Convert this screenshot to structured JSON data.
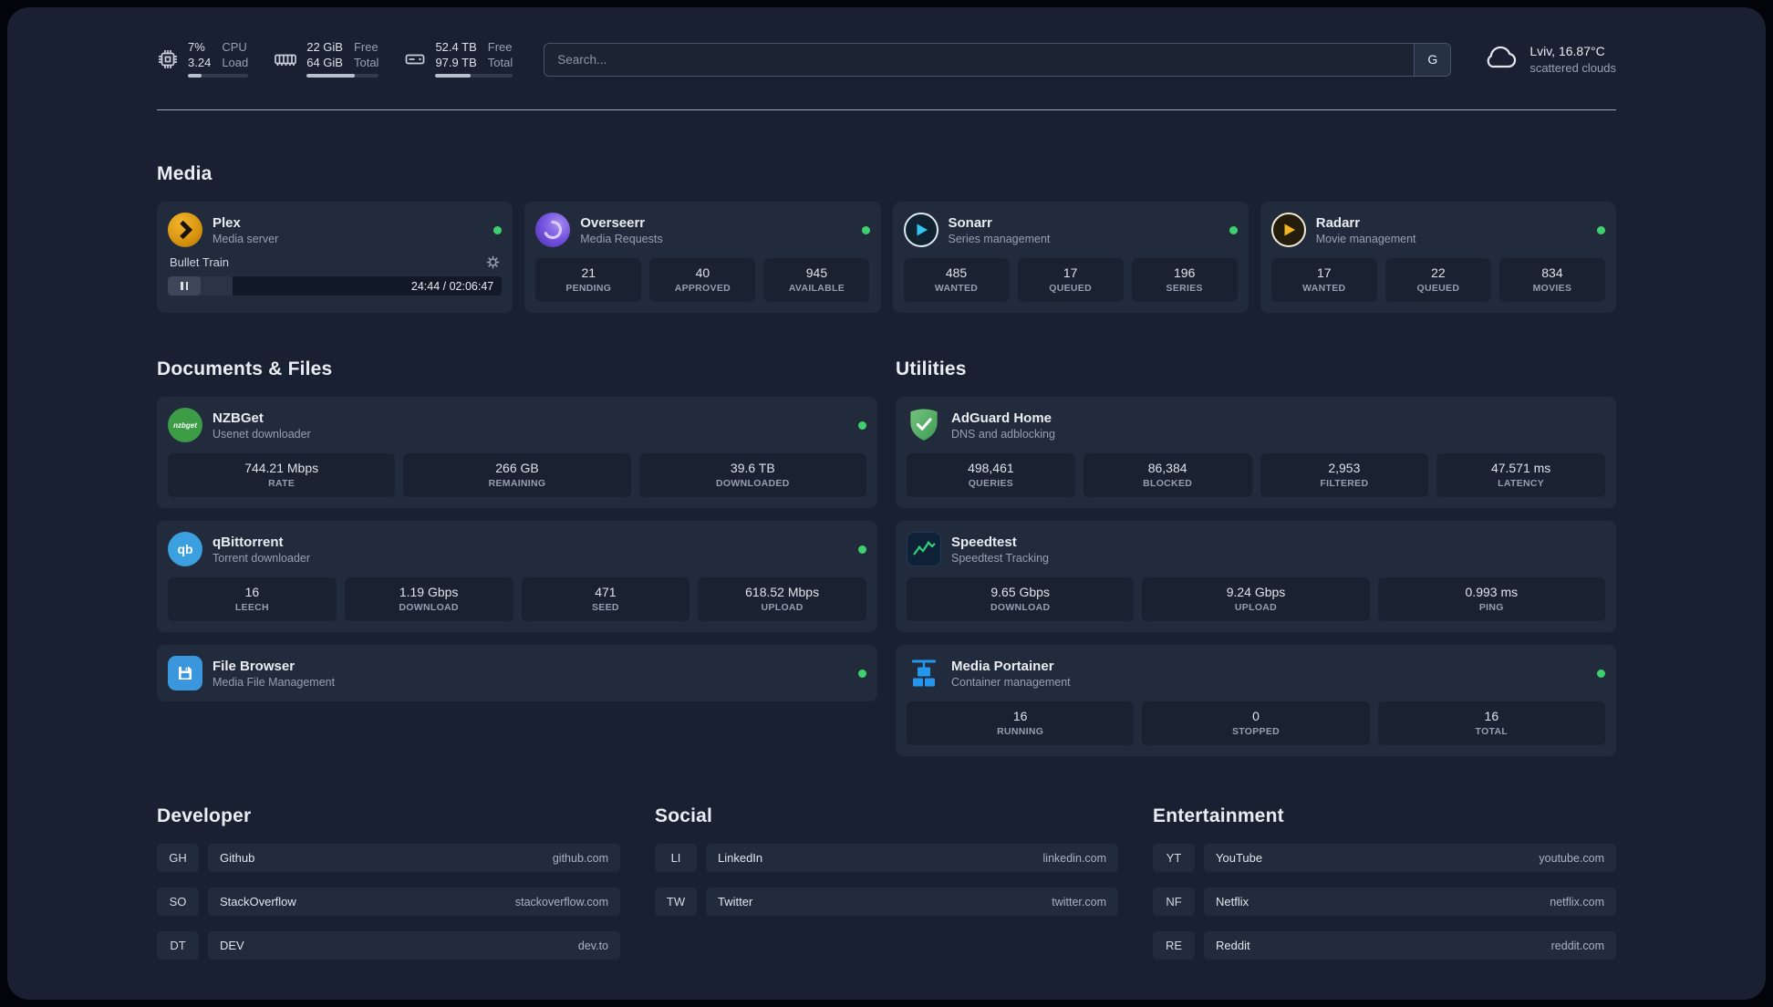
{
  "colors": {
    "status_online": "#3ecf6e",
    "accent_plex": "#e5a00d",
    "accent_overseerr": "#6741d9",
    "accent_sonarr": "#35c5f4",
    "accent_radarr": "#f3b61f",
    "accent_nzbget": "#3d9c46",
    "accent_qbittorrent": "#3b9fe0",
    "accent_filebrowser": "#3b97dd",
    "accent_adguard": "#5fb370",
    "accent_speedtest_line": "#2fd17c",
    "accent_portainer": "#2496ed"
  },
  "topbar": {
    "cpu": {
      "value1": "7%",
      "label1": "CPU",
      "value2": "3.24",
      "label2": "Load",
      "progress_pct": "22%"
    },
    "memory": {
      "value1": "22 GiB",
      "label1": "Free",
      "value2": "64 GiB",
      "label2": "Total",
      "progress_pct": "66%"
    },
    "disk": {
      "value1": "52.4 TB",
      "label1": "Free",
      "value2": "97.9 TB",
      "label2": "Total",
      "progress_pct": "46%"
    },
    "search": {
      "placeholder": "Search...",
      "engine_label": "G"
    },
    "weather": {
      "location": "Lviv, 16.87°C",
      "condition": "scattered clouds"
    }
  },
  "media": {
    "title": "Media",
    "cards": [
      {
        "name": "Plex",
        "subtitle": "Media server",
        "online": true,
        "player": {
          "title": "Bullet Train",
          "time": "24:44 / 02:06:47",
          "progress_pct": "19.5%"
        }
      },
      {
        "name": "Overseerr",
        "subtitle": "Media Requests",
        "online": true,
        "stats": [
          {
            "value": "21",
            "label": "PENDING"
          },
          {
            "value": "40",
            "label": "APPROVED"
          },
          {
            "value": "945",
            "label": "AVAILABLE"
          }
        ]
      },
      {
        "name": "Sonarr",
        "subtitle": "Series management",
        "online": true,
        "stats": [
          {
            "value": "485",
            "label": "WANTED"
          },
          {
            "value": "17",
            "label": "QUEUED"
          },
          {
            "value": "196",
            "label": "SERIES"
          }
        ]
      },
      {
        "name": "Radarr",
        "subtitle": "Movie management",
        "online": true,
        "stats": [
          {
            "value": "17",
            "label": "WANTED"
          },
          {
            "value": "22",
            "label": "QUEUED"
          },
          {
            "value": "834",
            "label": "MOVIES"
          }
        ]
      }
    ]
  },
  "documents": {
    "title": "Documents & Files",
    "cards": [
      {
        "name": "NZBGet",
        "subtitle": "Usenet downloader",
        "online": true,
        "icon_text": "nzbget",
        "stats": [
          {
            "value": "744.21 Mbps",
            "label": "RATE"
          },
          {
            "value": "266 GB",
            "label": "REMAINING"
          },
          {
            "value": "39.6 TB",
            "label": "DOWNLOADED"
          }
        ]
      },
      {
        "name": "qBittorrent",
        "subtitle": "Torrent downloader",
        "online": true,
        "icon_text": "qb",
        "stats": [
          {
            "value": "16",
            "label": "LEECH"
          },
          {
            "value": "1.19 Gbps",
            "label": "DOWNLOAD"
          },
          {
            "value": "471",
            "label": "SEED"
          },
          {
            "value": "618.52 Mbps",
            "label": "UPLOAD"
          }
        ]
      },
      {
        "name": "File Browser",
        "subtitle": "Media File Management",
        "online": true
      }
    ]
  },
  "utilities": {
    "title": "Utilities",
    "cards": [
      {
        "name": "AdGuard Home",
        "subtitle": "DNS and adblocking",
        "online": false,
        "stats": [
          {
            "value": "498,461",
            "label": "QUERIES"
          },
          {
            "value": "86,384",
            "label": "BLOCKED"
          },
          {
            "value": "2,953",
            "label": "FILTERED"
          },
          {
            "value": "47.571 ms",
            "label": "LATENCY"
          }
        ]
      },
      {
        "name": "Speedtest",
        "subtitle": "Speedtest Tracking",
        "online": false,
        "stats": [
          {
            "value": "9.65 Gbps",
            "label": "DOWNLOAD"
          },
          {
            "value": "9.24 Gbps",
            "label": "UPLOAD"
          },
          {
            "value": "0.993 ms",
            "label": "PING"
          }
        ]
      },
      {
        "name": "Media Portainer",
        "subtitle": "Container management",
        "online": true,
        "stats": [
          {
            "value": "16",
            "label": "RUNNING"
          },
          {
            "value": "0",
            "label": "STOPPED"
          },
          {
            "value": "16",
            "label": "TOTAL"
          }
        ]
      }
    ]
  },
  "bookmarks": {
    "groups": [
      {
        "title": "Developer",
        "items": [
          {
            "abbr": "GH",
            "name": "Github",
            "url": "github.com"
          },
          {
            "abbr": "SO",
            "name": "StackOverflow",
            "url": "stackoverflow.com"
          },
          {
            "abbr": "DT",
            "name": "DEV",
            "url": "dev.to"
          }
        ]
      },
      {
        "title": "Social",
        "items": [
          {
            "abbr": "LI",
            "name": "LinkedIn",
            "url": "linkedin.com"
          },
          {
            "abbr": "TW",
            "name": "Twitter",
            "url": "twitter.com"
          }
        ]
      },
      {
        "title": "Entertainment",
        "items": [
          {
            "abbr": "YT",
            "name": "YouTube",
            "url": "youtube.com"
          },
          {
            "abbr": "NF",
            "name": "Netflix",
            "url": "netflix.com"
          },
          {
            "abbr": "RE",
            "name": "Reddit",
            "url": "reddit.com"
          }
        ]
      }
    ]
  }
}
